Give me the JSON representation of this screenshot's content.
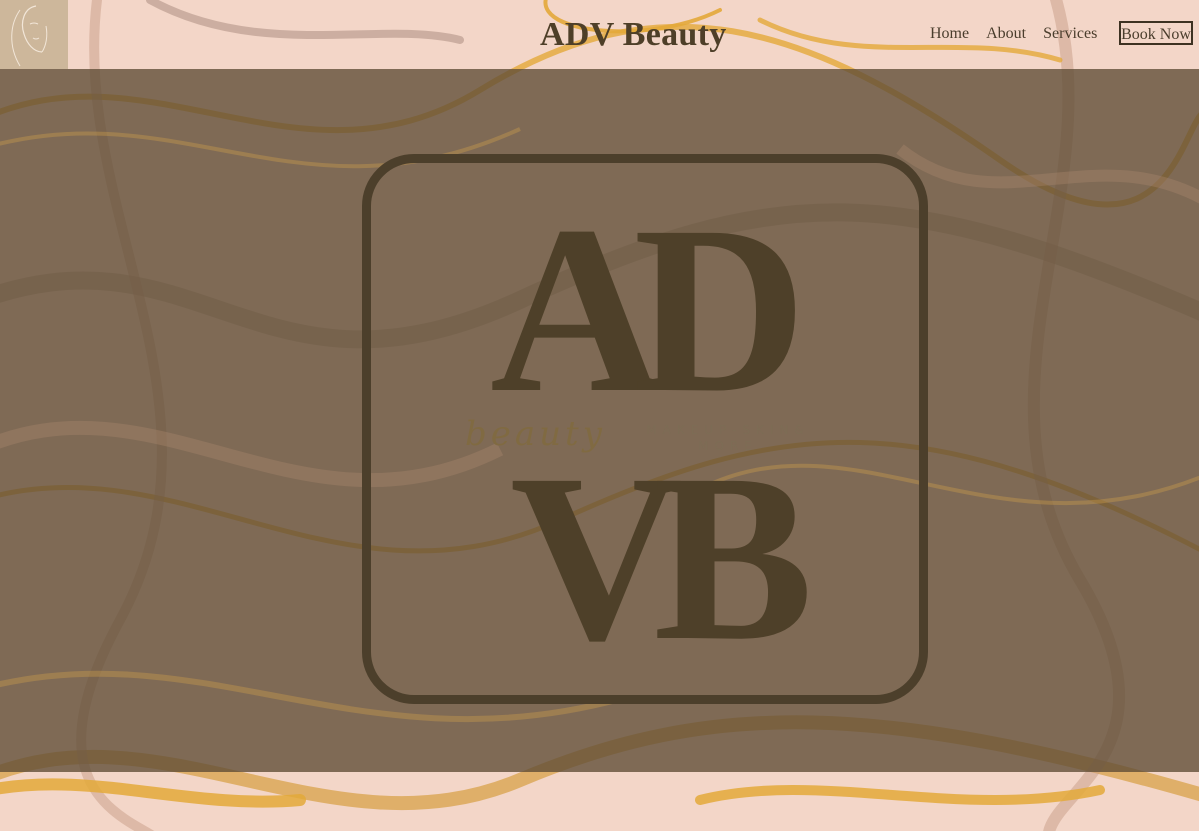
{
  "brand": {
    "title": "ADV Beauty"
  },
  "nav": {
    "items": [
      {
        "label": "Home"
      },
      {
        "label": "About"
      },
      {
        "label": "Services"
      }
    ],
    "cta_label": "Book Now"
  },
  "hero_logo": {
    "top_letters": "AD",
    "bottom_letters": "VB",
    "script_text": "beauty",
    "tagline": "MAKEUP-SKIN& MORE"
  },
  "colors": {
    "accent": "#4e4029",
    "overlay": "#5e4c34",
    "background": "#f3d6c8",
    "gold": "#e3a93a"
  }
}
